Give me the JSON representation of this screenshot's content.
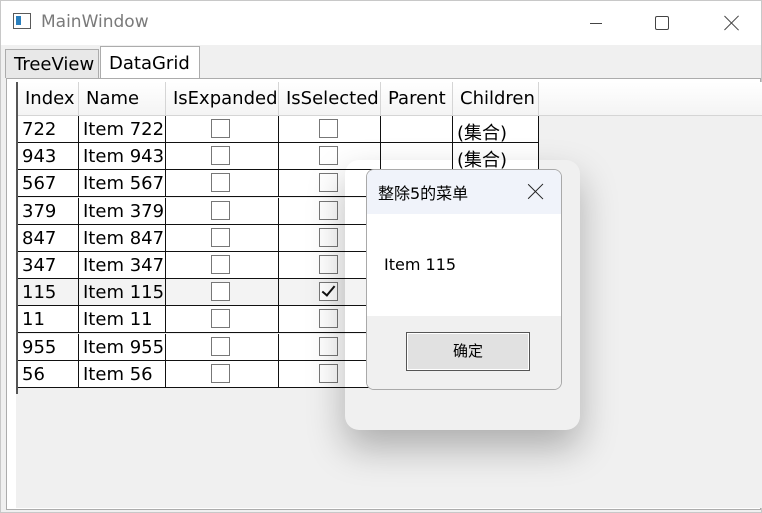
{
  "window": {
    "title": "MainWindow"
  },
  "tabs": [
    {
      "label": "TreeView"
    },
    {
      "label": "DataGrid"
    }
  ],
  "grid": {
    "columns": [
      "Index",
      "Name",
      "IsExpanded",
      "IsSelected",
      "Parent",
      "Children"
    ],
    "rows": [
      {
        "index": "722",
        "name": "Item 722",
        "expanded": false,
        "selected": false,
        "parent": "",
        "children": "(集合)"
      },
      {
        "index": "943",
        "name": "Item 943",
        "expanded": false,
        "selected": false,
        "parent": "",
        "children": "(集合)"
      },
      {
        "index": "567",
        "name": "Item 567",
        "expanded": false,
        "selected": false,
        "parent": "",
        "children": ""
      },
      {
        "index": "379",
        "name": "Item 379",
        "expanded": false,
        "selected": false,
        "parent": "",
        "children": ""
      },
      {
        "index": "847",
        "name": "Item 847",
        "expanded": false,
        "selected": false,
        "parent": "",
        "children": ""
      },
      {
        "index": "347",
        "name": "Item 347",
        "expanded": false,
        "selected": false,
        "parent": "",
        "children": ""
      },
      {
        "index": "115",
        "name": "Item 115",
        "expanded": false,
        "selected": true,
        "parent": "",
        "children": ""
      },
      {
        "index": "11",
        "name": "Item 11",
        "expanded": false,
        "selected": false,
        "parent": "",
        "children": ""
      },
      {
        "index": "955",
        "name": "Item 955",
        "expanded": false,
        "selected": false,
        "parent": "",
        "children": ""
      },
      {
        "index": "56",
        "name": "Item 56",
        "expanded": false,
        "selected": false,
        "parent": "",
        "children": ""
      }
    ]
  },
  "dialog": {
    "title": "整除5的菜单",
    "message": "Item 115",
    "ok_label": "确定"
  }
}
